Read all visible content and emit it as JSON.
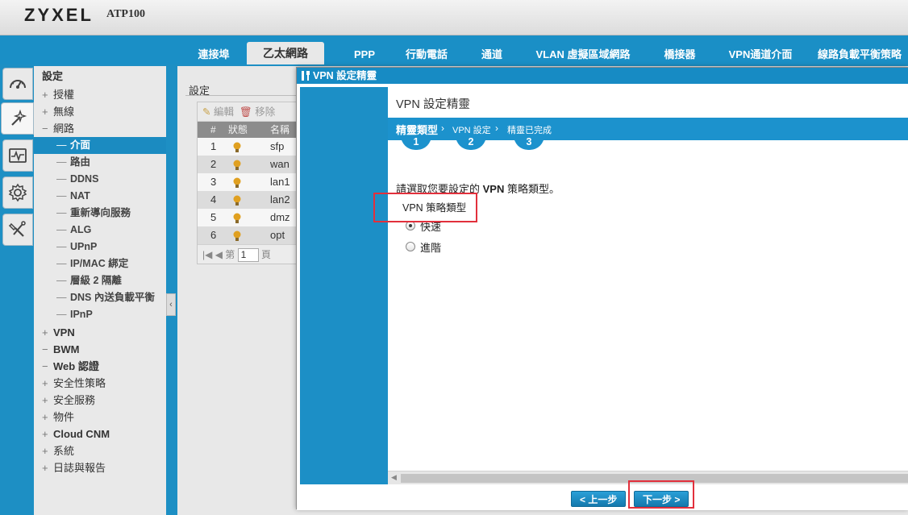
{
  "header": {
    "brand": "ZYXEL",
    "model": "ATP100"
  },
  "tabs": [
    {
      "label": "連接埠",
      "active": false
    },
    {
      "label": "乙太網路",
      "active": true
    },
    {
      "label": "PPP",
      "active": false
    },
    {
      "label": "行動電話",
      "active": false
    },
    {
      "label": "通道",
      "active": false
    },
    {
      "label": "VLAN 虛擬區域網路",
      "active": false
    },
    {
      "label": "橋接器",
      "active": false
    },
    {
      "label": "VPN通道介面",
      "active": false
    },
    {
      "label": "線路負載平衡策略",
      "active": false
    }
  ],
  "icon_sidebar": [
    "dashboard-icon",
    "configuration-wand-icon",
    "monitor-pulse-icon",
    "settings-gear-icon",
    "maintenance-tools-icon"
  ],
  "nav": {
    "title": "設定",
    "items": [
      {
        "label": "授權",
        "sign": "+"
      },
      {
        "label": "無線",
        "sign": "+"
      },
      {
        "label": "網路",
        "sign": "−"
      },
      {
        "label": "介面",
        "selected": true
      },
      {
        "label": "路由"
      },
      {
        "label": "DDNS"
      },
      {
        "label": "NAT"
      },
      {
        "label": "重新導向服務"
      },
      {
        "label": "ALG"
      },
      {
        "label": "UPnP"
      },
      {
        "label": "IP/MAC 綁定"
      },
      {
        "label": "層級 2 隔離"
      },
      {
        "label": "DNS 內送負載平衡"
      },
      {
        "label": "IPnP"
      },
      {
        "label": "VPN",
        "sign": "+"
      },
      {
        "label": "BWM",
        "sign": "−"
      },
      {
        "label": "Web 認證",
        "sign": "−"
      },
      {
        "label": "安全性策略",
        "sign": "+"
      },
      {
        "label": "安全服務",
        "sign": "+"
      },
      {
        "label": "物件",
        "sign": "+"
      },
      {
        "label": "Cloud CNM",
        "sign": "+"
      },
      {
        "label": "系統",
        "sign": "+"
      },
      {
        "label": "日誌與報告",
        "sign": "+"
      }
    ]
  },
  "content": {
    "title": "設定",
    "toolbar": {
      "edit": "編輯",
      "remove": "移除"
    },
    "columns": {
      "num": "#",
      "status": "狀態",
      "name": "名稱"
    },
    "rows": [
      {
        "num": "1",
        "name": "sfp"
      },
      {
        "num": "2",
        "name": "wan"
      },
      {
        "num": "3",
        "name": "lan1"
      },
      {
        "num": "4",
        "name": "lan2"
      },
      {
        "num": "5",
        "name": "dmz"
      },
      {
        "num": "6",
        "name": "opt"
      }
    ],
    "pager": {
      "page_prefix": "第",
      "page_value": "1",
      "page_suffix": "頁"
    }
  },
  "dialog": {
    "title": "VPN 設定精靈",
    "heading": "VPN 設定精靈",
    "steps": [
      {
        "label": "精靈類型",
        "num": "1"
      },
      {
        "label": "VPN 設定",
        "num": "2"
      },
      {
        "label": "精靈已完成",
        "num": "3"
      }
    ],
    "instruction_prefix": "請選取您要設定的 ",
    "instruction_bold": "VPN",
    "instruction_suffix": " 策略類型。",
    "group_label": "VPN 策略類型",
    "options": [
      {
        "label": "快速",
        "checked": true
      },
      {
        "label": "進階",
        "checked": false
      }
    ],
    "back_button": "< 上一步",
    "next_button": "下一步 >"
  },
  "colors": {
    "accent": "#1d8fc4",
    "highlight": "#e2303c",
    "bulb": "#e0a020"
  }
}
